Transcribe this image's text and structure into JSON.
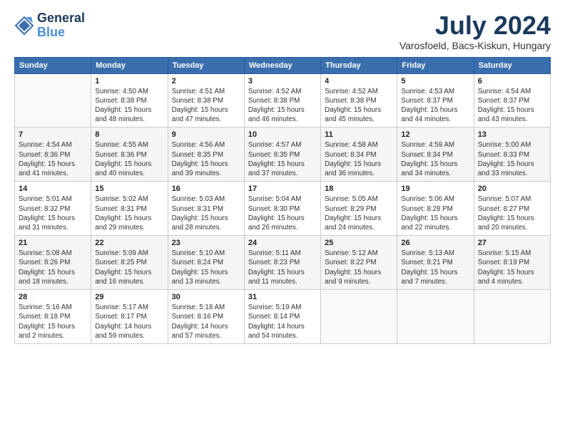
{
  "logo": {
    "line1": "General",
    "line2": "Blue"
  },
  "title": "July 2024",
  "subtitle": "Varosfoeld, Bacs-Kiskun, Hungary",
  "columns": [
    "Sunday",
    "Monday",
    "Tuesday",
    "Wednesday",
    "Thursday",
    "Friday",
    "Saturday"
  ],
  "weeks": [
    [
      {
        "day": "",
        "info": ""
      },
      {
        "day": "1",
        "info": "Sunrise: 4:50 AM\nSunset: 8:38 PM\nDaylight: 15 hours\nand 48 minutes."
      },
      {
        "day": "2",
        "info": "Sunrise: 4:51 AM\nSunset: 8:38 PM\nDaylight: 15 hours\nand 47 minutes."
      },
      {
        "day": "3",
        "info": "Sunrise: 4:52 AM\nSunset: 8:38 PM\nDaylight: 15 hours\nand 46 minutes."
      },
      {
        "day": "4",
        "info": "Sunrise: 4:52 AM\nSunset: 8:38 PM\nDaylight: 15 hours\nand 45 minutes."
      },
      {
        "day": "5",
        "info": "Sunrise: 4:53 AM\nSunset: 8:37 PM\nDaylight: 15 hours\nand 44 minutes."
      },
      {
        "day": "6",
        "info": "Sunrise: 4:54 AM\nSunset: 8:37 PM\nDaylight: 15 hours\nand 43 minutes."
      }
    ],
    [
      {
        "day": "7",
        "info": "Sunrise: 4:54 AM\nSunset: 8:36 PM\nDaylight: 15 hours\nand 41 minutes."
      },
      {
        "day": "8",
        "info": "Sunrise: 4:55 AM\nSunset: 8:36 PM\nDaylight: 15 hours\nand 40 minutes."
      },
      {
        "day": "9",
        "info": "Sunrise: 4:56 AM\nSunset: 8:35 PM\nDaylight: 15 hours\nand 39 minutes."
      },
      {
        "day": "10",
        "info": "Sunrise: 4:57 AM\nSunset: 8:35 PM\nDaylight: 15 hours\nand 37 minutes."
      },
      {
        "day": "11",
        "info": "Sunrise: 4:58 AM\nSunset: 8:34 PM\nDaylight: 15 hours\nand 36 minutes."
      },
      {
        "day": "12",
        "info": "Sunrise: 4:59 AM\nSunset: 8:34 PM\nDaylight: 15 hours\nand 34 minutes."
      },
      {
        "day": "13",
        "info": "Sunrise: 5:00 AM\nSunset: 8:33 PM\nDaylight: 15 hours\nand 33 minutes."
      }
    ],
    [
      {
        "day": "14",
        "info": "Sunrise: 5:01 AM\nSunset: 8:32 PM\nDaylight: 15 hours\nand 31 minutes."
      },
      {
        "day": "15",
        "info": "Sunrise: 5:02 AM\nSunset: 8:31 PM\nDaylight: 15 hours\nand 29 minutes."
      },
      {
        "day": "16",
        "info": "Sunrise: 5:03 AM\nSunset: 8:31 PM\nDaylight: 15 hours\nand 28 minutes."
      },
      {
        "day": "17",
        "info": "Sunrise: 5:04 AM\nSunset: 8:30 PM\nDaylight: 15 hours\nand 26 minutes."
      },
      {
        "day": "18",
        "info": "Sunrise: 5:05 AM\nSunset: 8:29 PM\nDaylight: 15 hours\nand 24 minutes."
      },
      {
        "day": "19",
        "info": "Sunrise: 5:06 AM\nSunset: 8:28 PM\nDaylight: 15 hours\nand 22 minutes."
      },
      {
        "day": "20",
        "info": "Sunrise: 5:07 AM\nSunset: 8:27 PM\nDaylight: 15 hours\nand 20 minutes."
      }
    ],
    [
      {
        "day": "21",
        "info": "Sunrise: 5:08 AM\nSunset: 8:26 PM\nDaylight: 15 hours\nand 18 minutes."
      },
      {
        "day": "22",
        "info": "Sunrise: 5:09 AM\nSunset: 8:25 PM\nDaylight: 15 hours\nand 16 minutes."
      },
      {
        "day": "23",
        "info": "Sunrise: 5:10 AM\nSunset: 8:24 PM\nDaylight: 15 hours\nand 13 minutes."
      },
      {
        "day": "24",
        "info": "Sunrise: 5:11 AM\nSunset: 8:23 PM\nDaylight: 15 hours\nand 11 minutes."
      },
      {
        "day": "25",
        "info": "Sunrise: 5:12 AM\nSunset: 8:22 PM\nDaylight: 15 hours\nand 9 minutes."
      },
      {
        "day": "26",
        "info": "Sunrise: 5:13 AM\nSunset: 8:21 PM\nDaylight: 15 hours\nand 7 minutes."
      },
      {
        "day": "27",
        "info": "Sunrise: 5:15 AM\nSunset: 8:19 PM\nDaylight: 15 hours\nand 4 minutes."
      }
    ],
    [
      {
        "day": "28",
        "info": "Sunrise: 5:16 AM\nSunset: 8:18 PM\nDaylight: 15 hours\nand 2 minutes."
      },
      {
        "day": "29",
        "info": "Sunrise: 5:17 AM\nSunset: 8:17 PM\nDaylight: 14 hours\nand 59 minutes."
      },
      {
        "day": "30",
        "info": "Sunrise: 5:18 AM\nSunset: 8:16 PM\nDaylight: 14 hours\nand 57 minutes."
      },
      {
        "day": "31",
        "info": "Sunrise: 5:19 AM\nSunset: 8:14 PM\nDaylight: 14 hours\nand 54 minutes."
      },
      {
        "day": "",
        "info": ""
      },
      {
        "day": "",
        "info": ""
      },
      {
        "day": "",
        "info": ""
      }
    ]
  ]
}
